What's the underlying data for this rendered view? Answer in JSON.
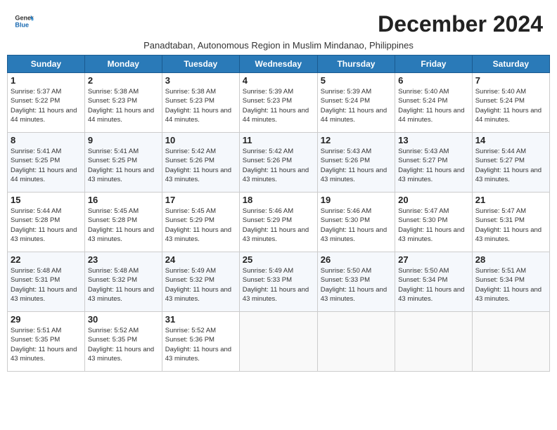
{
  "header": {
    "logo_line1": "General",
    "logo_line2": "Blue",
    "month_title": "December 2024",
    "subtitle": "Panadtaban, Autonomous Region in Muslim Mindanao, Philippines"
  },
  "days_of_week": [
    "Sunday",
    "Monday",
    "Tuesday",
    "Wednesday",
    "Thursday",
    "Friday",
    "Saturday"
  ],
  "weeks": [
    [
      {
        "day": 1,
        "sunrise": "5:37 AM",
        "sunset": "5:22 PM",
        "daylight": "11 hours and 44 minutes"
      },
      {
        "day": 2,
        "sunrise": "5:38 AM",
        "sunset": "5:23 PM",
        "daylight": "11 hours and 44 minutes"
      },
      {
        "day": 3,
        "sunrise": "5:38 AM",
        "sunset": "5:23 PM",
        "daylight": "11 hours and 44 minutes"
      },
      {
        "day": 4,
        "sunrise": "5:39 AM",
        "sunset": "5:23 PM",
        "daylight": "11 hours and 44 minutes"
      },
      {
        "day": 5,
        "sunrise": "5:39 AM",
        "sunset": "5:24 PM",
        "daylight": "11 hours and 44 minutes"
      },
      {
        "day": 6,
        "sunrise": "5:40 AM",
        "sunset": "5:24 PM",
        "daylight": "11 hours and 44 minutes"
      },
      {
        "day": 7,
        "sunrise": "5:40 AM",
        "sunset": "5:24 PM",
        "daylight": "11 hours and 44 minutes"
      }
    ],
    [
      {
        "day": 8,
        "sunrise": "5:41 AM",
        "sunset": "5:25 PM",
        "daylight": "11 hours and 44 minutes"
      },
      {
        "day": 9,
        "sunrise": "5:41 AM",
        "sunset": "5:25 PM",
        "daylight": "11 hours and 43 minutes"
      },
      {
        "day": 10,
        "sunrise": "5:42 AM",
        "sunset": "5:26 PM",
        "daylight": "11 hours and 43 minutes"
      },
      {
        "day": 11,
        "sunrise": "5:42 AM",
        "sunset": "5:26 PM",
        "daylight": "11 hours and 43 minutes"
      },
      {
        "day": 12,
        "sunrise": "5:43 AM",
        "sunset": "5:26 PM",
        "daylight": "11 hours and 43 minutes"
      },
      {
        "day": 13,
        "sunrise": "5:43 AM",
        "sunset": "5:27 PM",
        "daylight": "11 hours and 43 minutes"
      },
      {
        "day": 14,
        "sunrise": "5:44 AM",
        "sunset": "5:27 PM",
        "daylight": "11 hours and 43 minutes"
      }
    ],
    [
      {
        "day": 15,
        "sunrise": "5:44 AM",
        "sunset": "5:28 PM",
        "daylight": "11 hours and 43 minutes"
      },
      {
        "day": 16,
        "sunrise": "5:45 AM",
        "sunset": "5:28 PM",
        "daylight": "11 hours and 43 minutes"
      },
      {
        "day": 17,
        "sunrise": "5:45 AM",
        "sunset": "5:29 PM",
        "daylight": "11 hours and 43 minutes"
      },
      {
        "day": 18,
        "sunrise": "5:46 AM",
        "sunset": "5:29 PM",
        "daylight": "11 hours and 43 minutes"
      },
      {
        "day": 19,
        "sunrise": "5:46 AM",
        "sunset": "5:30 PM",
        "daylight": "11 hours and 43 minutes"
      },
      {
        "day": 20,
        "sunrise": "5:47 AM",
        "sunset": "5:30 PM",
        "daylight": "11 hours and 43 minutes"
      },
      {
        "day": 21,
        "sunrise": "5:47 AM",
        "sunset": "5:31 PM",
        "daylight": "11 hours and 43 minutes"
      }
    ],
    [
      {
        "day": 22,
        "sunrise": "5:48 AM",
        "sunset": "5:31 PM",
        "daylight": "11 hours and 43 minutes"
      },
      {
        "day": 23,
        "sunrise": "5:48 AM",
        "sunset": "5:32 PM",
        "daylight": "11 hours and 43 minutes"
      },
      {
        "day": 24,
        "sunrise": "5:49 AM",
        "sunset": "5:32 PM",
        "daylight": "11 hours and 43 minutes"
      },
      {
        "day": 25,
        "sunrise": "5:49 AM",
        "sunset": "5:33 PM",
        "daylight": "11 hours and 43 minutes"
      },
      {
        "day": 26,
        "sunrise": "5:50 AM",
        "sunset": "5:33 PM",
        "daylight": "11 hours and 43 minutes"
      },
      {
        "day": 27,
        "sunrise": "5:50 AM",
        "sunset": "5:34 PM",
        "daylight": "11 hours and 43 minutes"
      },
      {
        "day": 28,
        "sunrise": "5:51 AM",
        "sunset": "5:34 PM",
        "daylight": "11 hours and 43 minutes"
      }
    ],
    [
      {
        "day": 29,
        "sunrise": "5:51 AM",
        "sunset": "5:35 PM",
        "daylight": "11 hours and 43 minutes"
      },
      {
        "day": 30,
        "sunrise": "5:52 AM",
        "sunset": "5:35 PM",
        "daylight": "11 hours and 43 minutes"
      },
      {
        "day": 31,
        "sunrise": "5:52 AM",
        "sunset": "5:36 PM",
        "daylight": "11 hours and 43 minutes"
      },
      null,
      null,
      null,
      null
    ]
  ]
}
